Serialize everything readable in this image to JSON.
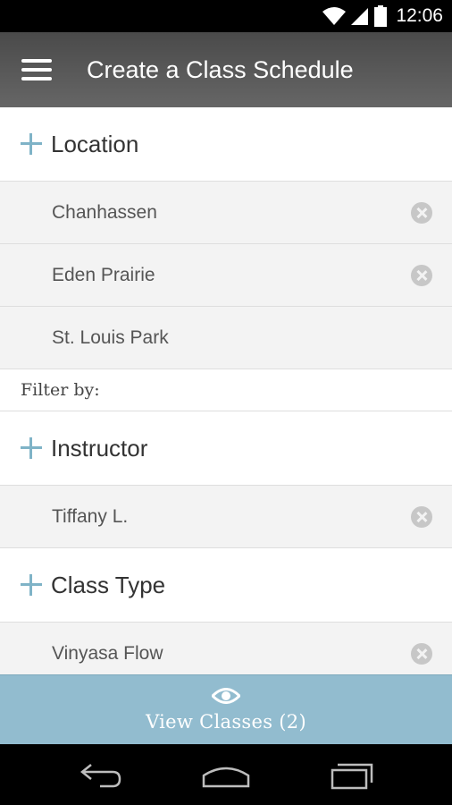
{
  "status_bar": {
    "time": "12:06"
  },
  "app_bar": {
    "title": "Create a Class Schedule"
  },
  "location": {
    "label": "Location",
    "items": [
      "Chanhassen",
      "Eden Prairie",
      "St. Louis Park"
    ]
  },
  "filter": {
    "label": "Filter by:"
  },
  "instructor": {
    "label": "Instructor",
    "items": [
      "Tiffany L."
    ]
  },
  "class_type": {
    "label": "Class Type",
    "items": [
      "Vinyasa Flow"
    ]
  },
  "view_button": {
    "label": "View Classes (2)"
  },
  "colors": {
    "accent": "#92bccf",
    "plus": "#7fb3c7",
    "app_bar": "#555555"
  },
  "icons": [
    "wifi-icon",
    "signal-icon",
    "battery-icon",
    "menu-icon",
    "plus-icon",
    "remove-icon",
    "eye-icon",
    "back-icon",
    "home-icon",
    "recents-icon"
  ]
}
